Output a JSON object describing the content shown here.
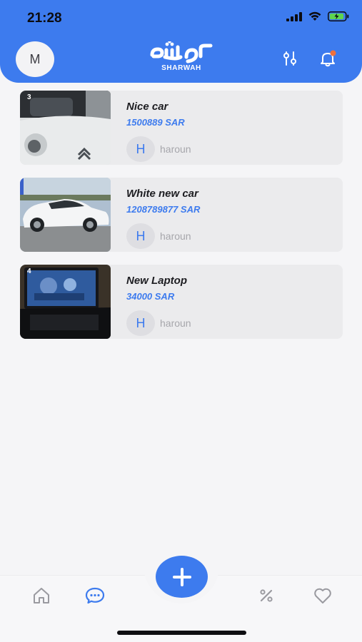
{
  "status_bar": {
    "time": "21:28"
  },
  "header": {
    "profile_initial": "M",
    "brand_arabic": "شروه",
    "brand_latin": "SHARWAH",
    "notification_dot_color": "#f0703c"
  },
  "listings": [
    {
      "thumb_badge": "3",
      "title": "Nice car",
      "price": "1500889 SAR",
      "seller_initial": "H",
      "seller_name": "haroun"
    },
    {
      "thumb_badge": "",
      "title": "White new car",
      "price": "1208789877 SAR",
      "seller_initial": "H",
      "seller_name": "haroun"
    },
    {
      "thumb_badge": "4",
      "title": "New Laptop",
      "price": "34000 SAR",
      "seller_initial": "H",
      "seller_name": "haroun"
    }
  ],
  "bottom_nav": {
    "items": [
      {
        "icon": "home-icon",
        "active": false
      },
      {
        "icon": "chat-icon",
        "active": true
      },
      {
        "icon": "add-icon",
        "active": false
      },
      {
        "icon": "percent-icon",
        "active": false
      },
      {
        "icon": "heart-icon",
        "active": false
      }
    ]
  },
  "colors": {
    "brand": "#3d7bee",
    "background": "#f5f5f7",
    "card": "#ebebed",
    "inactive_icon": "#9a9aa0"
  }
}
